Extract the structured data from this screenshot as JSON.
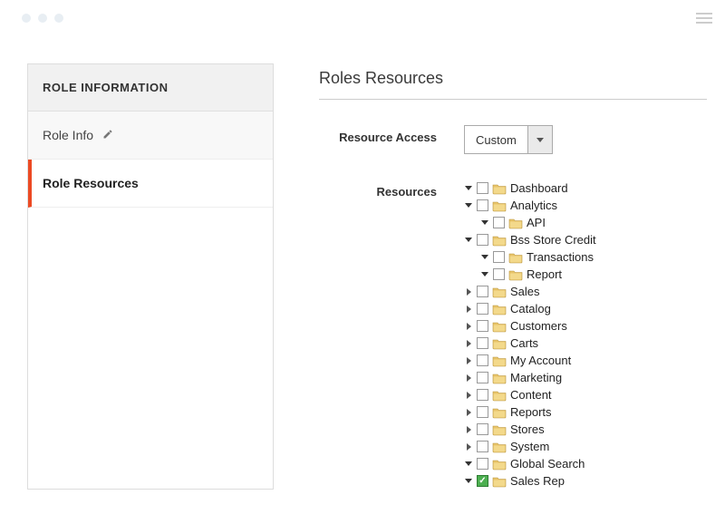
{
  "sidebar": {
    "header": "ROLE INFORMATION",
    "items": [
      {
        "label": "Role Info",
        "has_edit": true,
        "active": false
      },
      {
        "label": "Role Resources",
        "has_edit": false,
        "active": true
      }
    ]
  },
  "main": {
    "title": "Roles Resources",
    "resource_access": {
      "label": "Resource Access",
      "selected": "Custom"
    },
    "resources_label": "Resources",
    "tree": [
      {
        "label": "Dashboard",
        "expanded": true,
        "checked": false,
        "children": []
      },
      {
        "label": "Analytics",
        "expanded": true,
        "checked": false,
        "children": [
          {
            "label": "API",
            "expanded": true,
            "checked": false,
            "children": []
          }
        ]
      },
      {
        "label": "Bss Store Credit",
        "expanded": true,
        "checked": false,
        "children": [
          {
            "label": "Transactions",
            "expanded": true,
            "checked": false,
            "children": []
          },
          {
            "label": "Report",
            "expanded": true,
            "checked": false,
            "children": []
          }
        ]
      },
      {
        "label": "Sales",
        "expanded": false,
        "checked": false,
        "children": []
      },
      {
        "label": "Catalog",
        "expanded": false,
        "checked": false,
        "children": []
      },
      {
        "label": "Customers",
        "expanded": false,
        "checked": false,
        "children": []
      },
      {
        "label": "Carts",
        "expanded": false,
        "checked": false,
        "children": []
      },
      {
        "label": "My Account",
        "expanded": false,
        "checked": false,
        "children": []
      },
      {
        "label": "Marketing",
        "expanded": false,
        "checked": false,
        "children": []
      },
      {
        "label": "Content",
        "expanded": false,
        "checked": false,
        "children": []
      },
      {
        "label": "Reports",
        "expanded": false,
        "checked": false,
        "children": []
      },
      {
        "label": "Stores",
        "expanded": false,
        "checked": false,
        "children": []
      },
      {
        "label": "System",
        "expanded": false,
        "checked": false,
        "children": []
      },
      {
        "label": "Global Search",
        "expanded": true,
        "checked": false,
        "children": []
      },
      {
        "label": "Sales Rep",
        "expanded": true,
        "checked": true,
        "children": []
      }
    ]
  }
}
